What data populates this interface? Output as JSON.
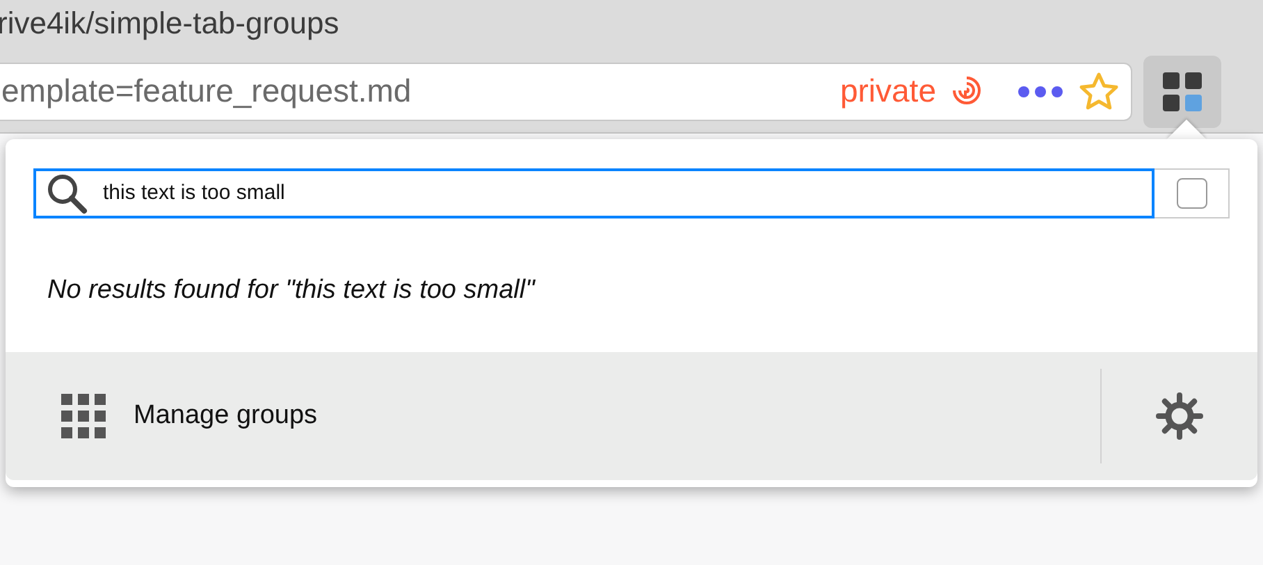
{
  "window": {
    "title": "rive4ik/simple-tab-groups"
  },
  "address_bar": {
    "url": "emplate=feature_request.md",
    "private_label": "private"
  },
  "popup": {
    "search": {
      "value": "this text is too small",
      "checked": false
    },
    "message": "No results found for \"this text is too small\"",
    "footer": {
      "manage_label": "Manage groups"
    }
  }
}
